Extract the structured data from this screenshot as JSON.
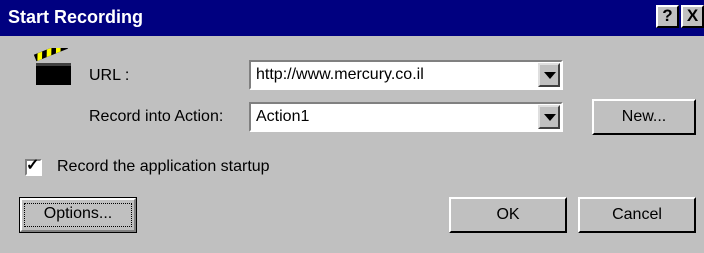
{
  "window": {
    "title": "Start Recording",
    "help_glyph": "?",
    "close_glyph": "X"
  },
  "url_field": {
    "label": "URL :",
    "value": "http://www.mercury.co.il"
  },
  "action_field": {
    "label": "Record into Action:",
    "value": "Action1",
    "new_button": "New..."
  },
  "startup_checkbox": {
    "label": "Record the application startup",
    "checked": true
  },
  "buttons": {
    "options": "Options...",
    "ok": "OK",
    "cancel": "Cancel"
  },
  "icons": {
    "app": "clapperboard-icon",
    "dropdown": "chevron-down-icon"
  },
  "colors": {
    "titlebar": "#000080",
    "face": "#c0c0c0"
  }
}
